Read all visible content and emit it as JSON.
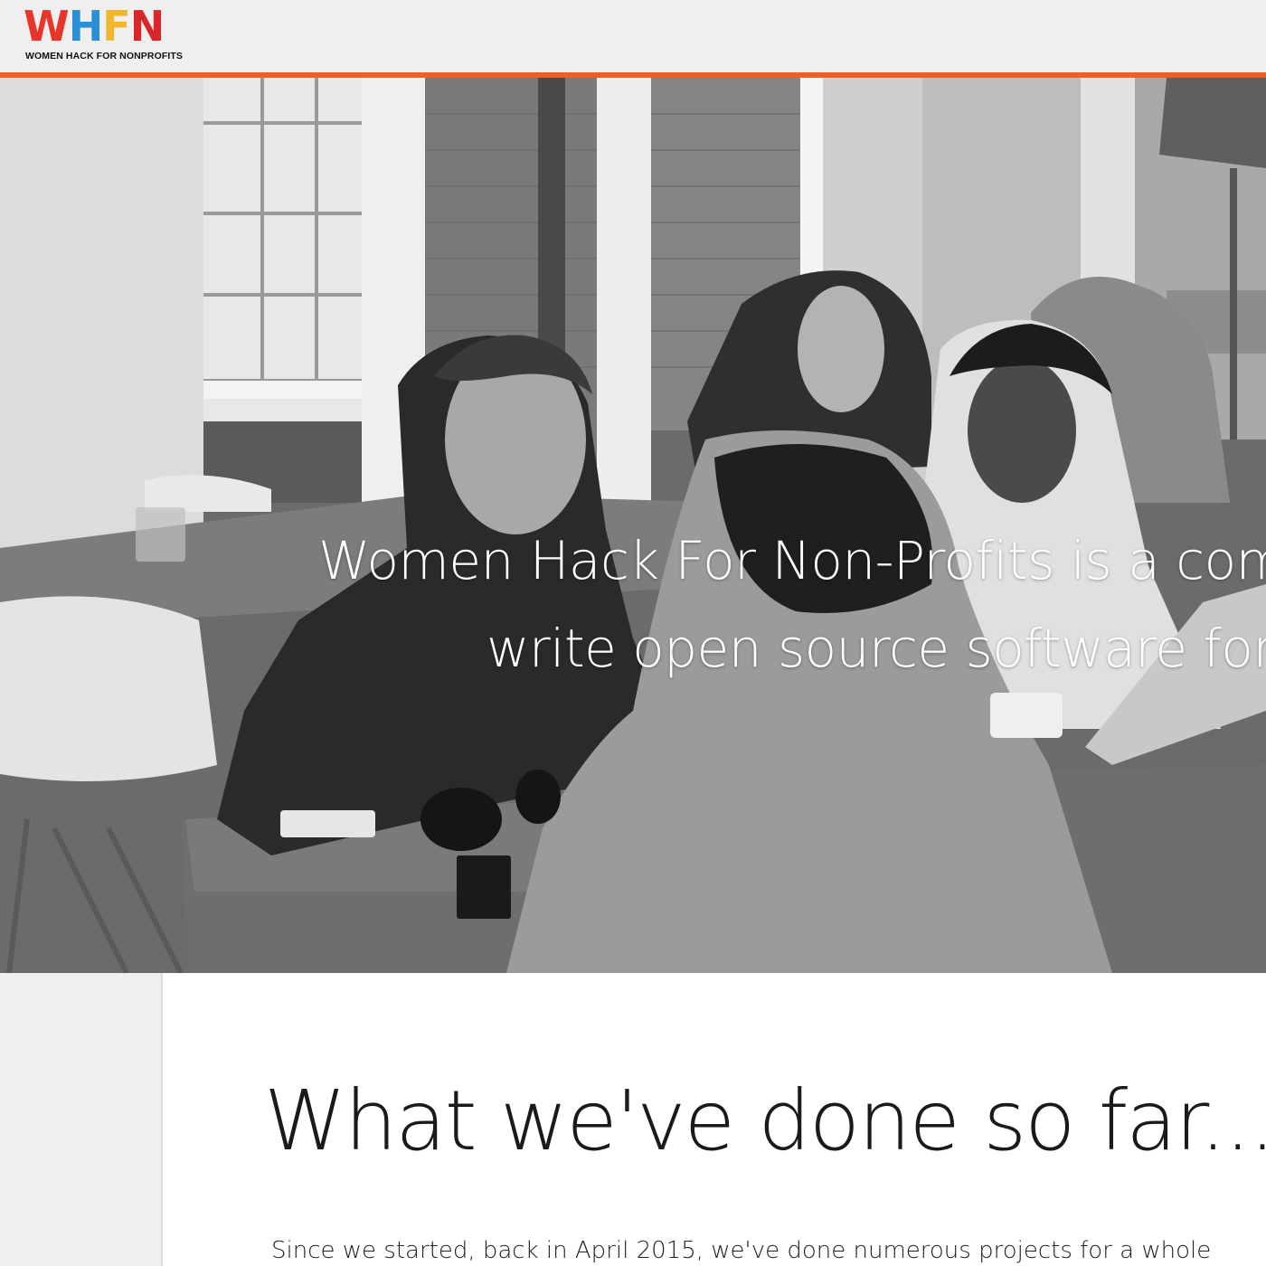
{
  "header": {
    "logo_mark": "WHFN",
    "logo_text": "WOMEN HACK FOR NONPROFITS",
    "accent_color": "#e8612c"
  },
  "hero": {
    "line1": "Women Hack For Non-Profits is a com",
    "line2": "write open source software for"
  },
  "section": {
    "title": "What we've done so far...",
    "body": "Since we started, back in April 2015, we've done numerous projects for a whole"
  },
  "icons": {
    "logo": "whfn-logo"
  }
}
